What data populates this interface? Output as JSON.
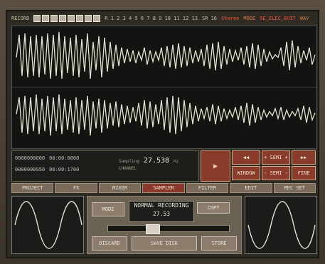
{
  "topbar": {
    "left_label": "RECORD",
    "meter_text": "R 1 2 3 4 5 6 7 8 9 10 11 12 13",
    "mid_label": "SR 16",
    "stereo": "Stereo",
    "stereo_tag": "MODE",
    "file": "SE_ELEC_GUIT",
    "file_tag": "WAV"
  },
  "info": {
    "line1_a": "0000000000",
    "line1_b": "00:00:0000",
    "line2_a": "0000000950",
    "line2_b": "00:00:1700",
    "mid_value": "27.538",
    "mid_small1": "Sampling",
    "mid_small2": "CHANNEL",
    "mid_small3": "Hz"
  },
  "controls": {
    "play": "▶",
    "top_mid": "+ SEMI +",
    "btn_left": "◀◀",
    "btn_right": "▶▶",
    "window": "WINDOW",
    "semi": "- SEMI -",
    "fine": "FINE"
  },
  "tabs": [
    {
      "label": "PROJECT"
    },
    {
      "label": "FX"
    },
    {
      "label": "MIXER"
    },
    {
      "label": "SAMPLER"
    },
    {
      "label": "FILTER"
    },
    {
      "label": "EDIT"
    },
    {
      "label": "REC SET"
    }
  ],
  "center": {
    "left_btn": "MODE",
    "normal_label": "NORMAL RECORDING",
    "normal_value": "27.53",
    "right_btn": "COPY",
    "bottom_left": "DISCARD",
    "bottom_mid": "SAVE DISK",
    "bottom_right": "STORE"
  },
  "slider": {
    "position": 0.35
  },
  "colors": {
    "accent": "#8a3c2c",
    "wave": "#e8e2d0"
  }
}
